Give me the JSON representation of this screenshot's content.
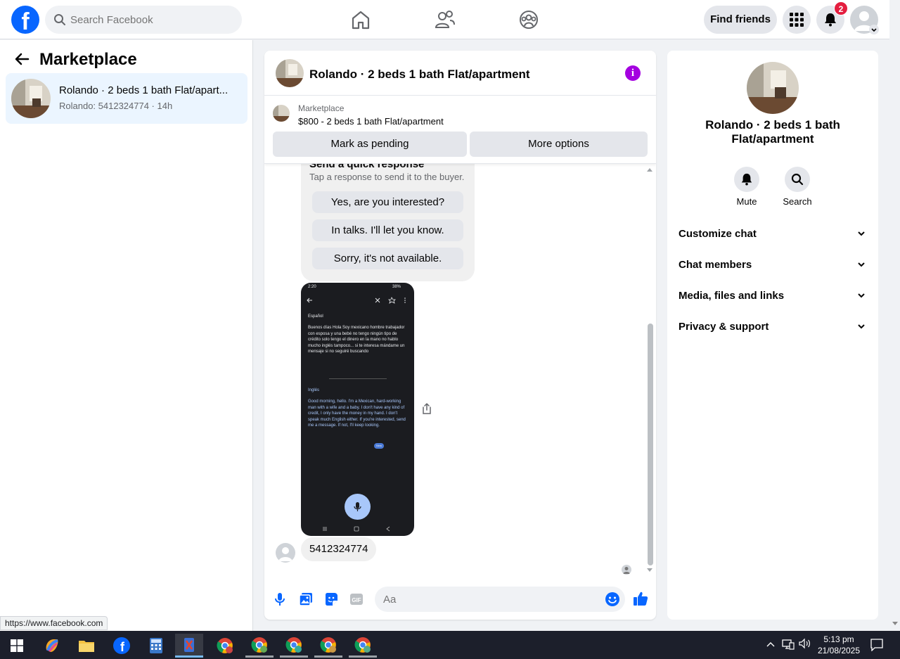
{
  "topbar": {
    "search_placeholder": "Search Facebook",
    "find_friends": "Find friends",
    "notifications_count": "2"
  },
  "left": {
    "title": "Marketplace",
    "conversation": {
      "title": "Rolando · 2 beds 1 bath Flat/apart...",
      "subtitle": "Rolando: 5412324774 · 14h"
    }
  },
  "chat": {
    "title": "Rolando · 2 beds 1 bath Flat/apartment",
    "listing": {
      "category": "Marketplace",
      "price_title": "$800 - 2 beds 1 bath Flat/apartment",
      "mark_pending": "Mark as pending",
      "more_options": "More options"
    },
    "quick": {
      "title": "Send a quick response",
      "subtitle": "Tap a response to send it to the buyer.",
      "responses": [
        "Yes, are you interested?",
        "In talks. I'll let you know.",
        "Sorry, it's not available."
      ]
    },
    "screenshot_text": {
      "status": "2:20",
      "battery": "38%",
      "lang1": "Español",
      "spanish": "Buenos días Hola Soy mexicano hombre trabajador con esposa y una bebé no tengo ningún tipo de crédito solo tengo el dinero en la mano no hablo mucho inglés tampoco... si te interesa mándame un mensaje si no seguiré buscando",
      "lang2": "Inglés",
      "english": "Good morning, hello. I'm a Mexican, hard-working man with a wife and a baby. I don't have any kind of credit, I only have the money in my hand. I don't speak much English either. If you're interested, send me a message. If not, I'll keep looking.",
      "new_badge": "New"
    },
    "last_message": "5412324774",
    "composer_placeholder": "Aa"
  },
  "right": {
    "title": "Rolando · 2 beds 1 bath Flat/apartment",
    "mute": "Mute",
    "search": "Search",
    "sections": [
      "Customize chat",
      "Chat members",
      "Media, files and links",
      "Privacy & support"
    ]
  },
  "status_url": "https://www.facebook.com",
  "taskbar": {
    "time": "5:13 pm",
    "date": "21/08/2025"
  },
  "colors": {
    "brand": "#0866ff",
    "info": "#a400e0",
    "badge": "#e41e3f",
    "selected_bg": "#ebf5ff"
  }
}
